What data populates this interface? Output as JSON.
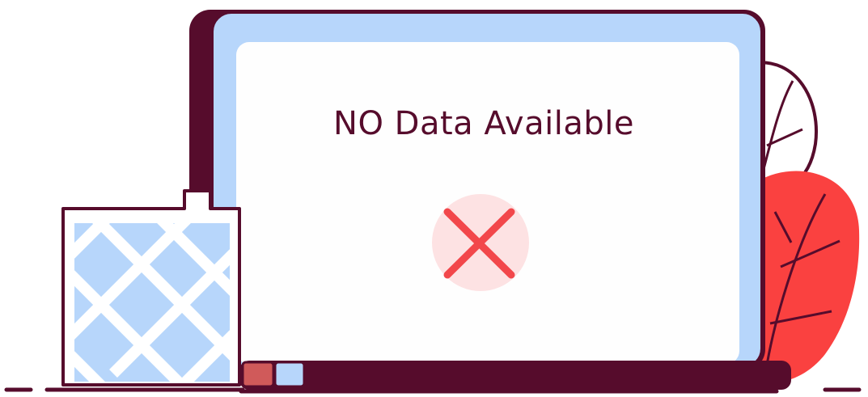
{
  "screen": {
    "message": "NO Data Available"
  },
  "icons": {
    "status": "error-x-icon",
    "plants": "leaf-icon",
    "window": "lattice-window-icon"
  },
  "colors": {
    "outline": "#560c2c",
    "laptop_bezel": "#b7d6fb",
    "screen_bg": "#fefefe",
    "error_red": "#f2474b",
    "error_circle": "#fde2e3",
    "leaf_red": "#fa4140",
    "window_pane": "#b7d6fb"
  }
}
